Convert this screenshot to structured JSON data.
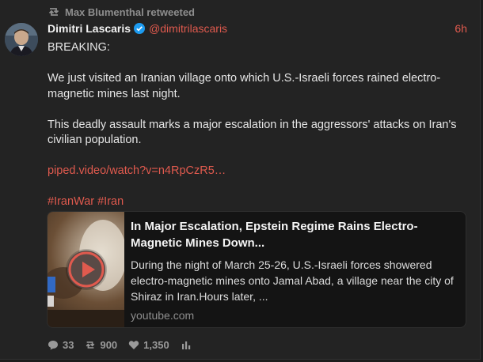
{
  "retweet": {
    "text": "Max Blumenthal retweeted"
  },
  "tweet": {
    "author": "Dimitri Lascaris",
    "handle": "@dimitrilascaris",
    "time": "6h",
    "paragraphs": [
      "BREAKING:",
      "We just visited an Iranian village onto which U.S.-Israeli forces rained electro-magnetic mines last night.",
      "This deadly assault marks a major escalation in the aggressors' attacks on Iran's civilian population."
    ],
    "link": "piped.video/watch?v=n4RpCzR5…",
    "hashtags": "#IranWar #Iran"
  },
  "embed": {
    "title": "In Major Escalation, Epstein Regime Rains Electro-Magnetic Mines Down...",
    "description": "During the night of March 25-26, U.S.-Israeli forces showered electro-magnetic mines onto Jamal Abad, a village near the city of Shiraz in Iran.Hours later, ...",
    "domain": "youtube.com"
  },
  "stats": {
    "replies": "33",
    "retweets": "900",
    "likes": "1,350"
  },
  "colors": {
    "accent": "#e05a4e",
    "muted": "#8e8e8e",
    "background": "#232323"
  },
  "icons": [
    "retweet-icon",
    "verified-badge-icon",
    "play-icon",
    "reply-icon",
    "like-icon",
    "stats-icon"
  ]
}
